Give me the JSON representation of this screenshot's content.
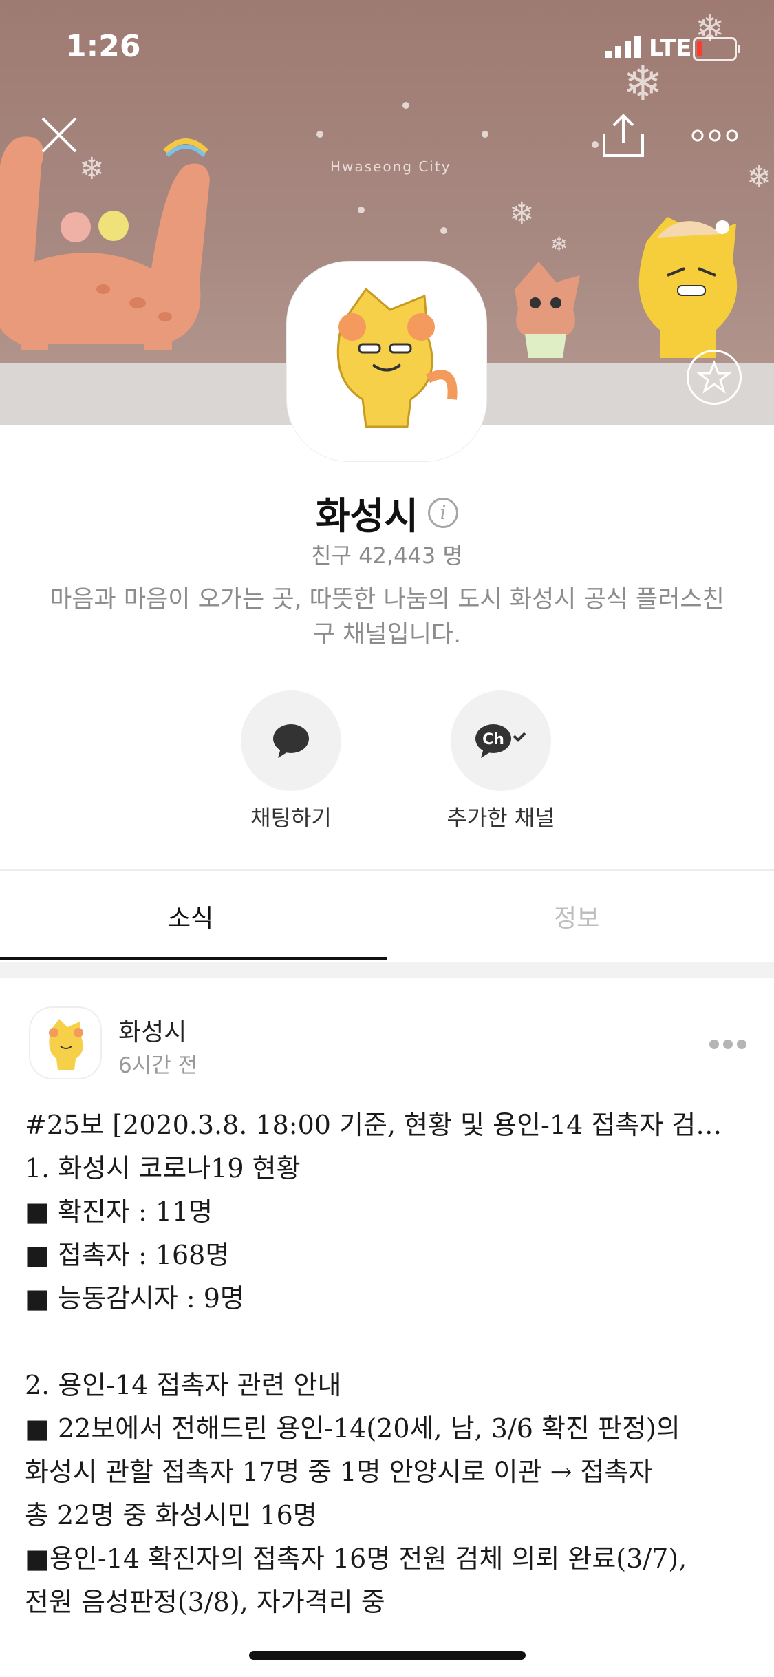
{
  "status_bar": {
    "time": "1:26",
    "network": "LTE",
    "battery_color": "#ff3b30"
  },
  "banner": {
    "city_text": "Hwaseong City",
    "bg_color": "#a88a82"
  },
  "header_actions": {
    "close_icon": "close-icon",
    "share_icon": "share-icon",
    "more_icon": "more-icon",
    "favorite_icon": "star-icon"
  },
  "profile": {
    "name": "화성시",
    "friends": "친구 42,443 명",
    "description": "마음과 마음이 오가는 곳, 따뜻한 나눔의 도시 화성시 공식 플러스친구 채널입니다."
  },
  "actions": [
    {
      "label": "채팅하기",
      "icon": "chat-bubble-icon"
    },
    {
      "label": "추가한 채널",
      "icon": "channel-added-icon",
      "icon_text": "Ch"
    }
  ],
  "tabs": [
    {
      "label": "소식",
      "active": true
    },
    {
      "label": "정보",
      "active": false
    }
  ],
  "post": {
    "author": "화성시",
    "time": "6시간 전",
    "title": "#25보 [2020.3.8. 18:00 기준, 현황 및 용인-14 접촉자 검…",
    "body": "1. 화성시 코로나19 현황\n■ 확진자 : 11명\n■ 접촉자 : 168명\n■ 능동감시자 : 9명\n\n2. 용인-14 접촉자 관련 안내\n■ 22보에서 전해드린 용인-14(20세, 남, 3/6 확진 판정)의\n화성시 관할 접촉자 17명 중 1명 안양시로 이관 → 접촉자\n총 22명 중 화성시민 16명\n■용인-14 확진자의 접촉자 16명 전원 검체 의뢰 완료(3/7),\n전원 음성판정(3/8), 자가격리 중"
  }
}
